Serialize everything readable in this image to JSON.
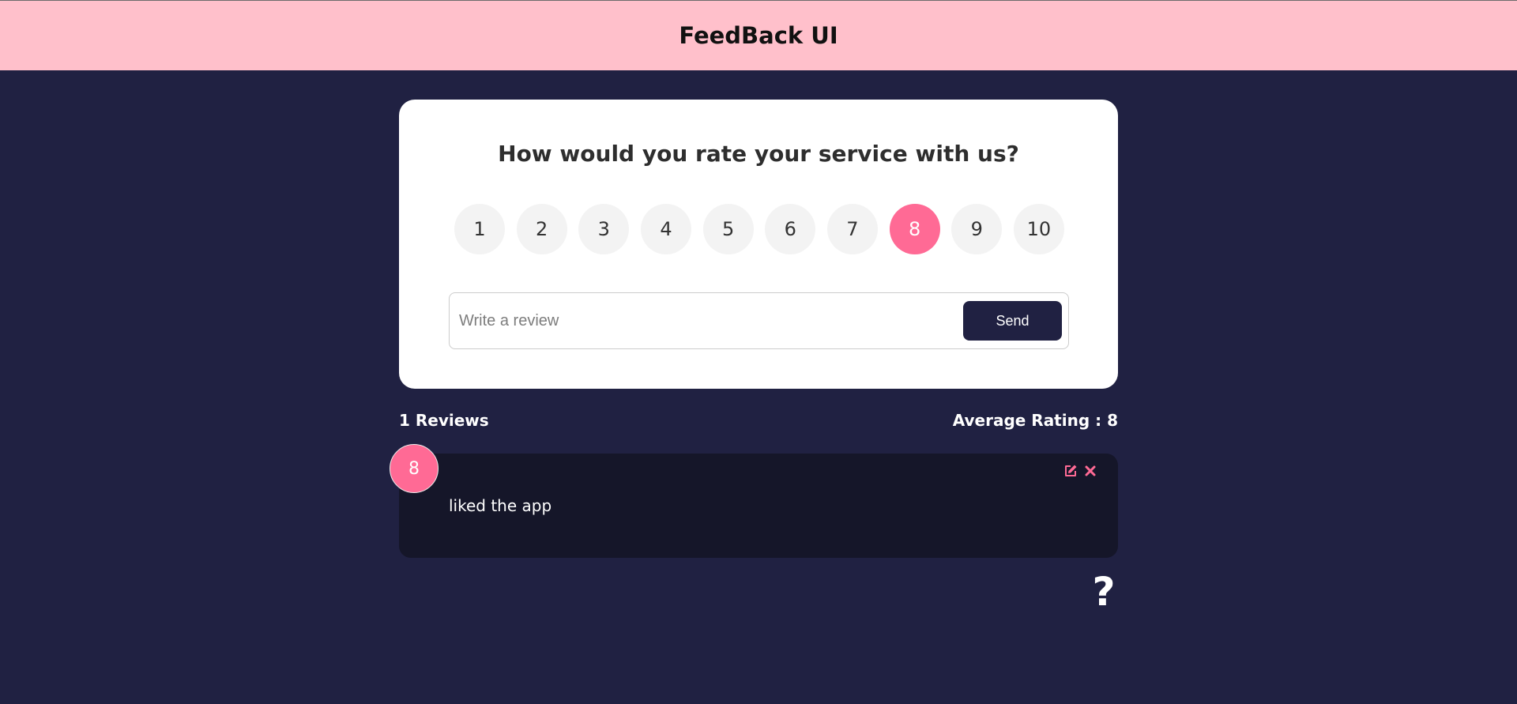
{
  "header": {
    "title": "FeedBack UI",
    "background_color": "#ffc0cb"
  },
  "rating_card": {
    "question": "How would you rate your service with us?",
    "options": [
      "1",
      "2",
      "3",
      "4",
      "5",
      "6",
      "7",
      "8",
      "9",
      "10"
    ],
    "selected": "8",
    "accent_color": "#ff6a95"
  },
  "review_form": {
    "placeholder": "Write a review",
    "value": "",
    "send_label": "Send"
  },
  "stats": {
    "review_count": "1 Reviews",
    "average_rating": "Average Rating : 8"
  },
  "reviews": [
    {
      "rating": "8",
      "text": "liked the app",
      "edit_icon": "edit-icon",
      "delete_icon": "close-icon"
    }
  ],
  "help": {
    "icon": "question-mark-icon",
    "glyph": "?"
  },
  "colors": {
    "page_background": "#202142",
    "card_background": "#ffffff",
    "review_background": "#151629"
  }
}
